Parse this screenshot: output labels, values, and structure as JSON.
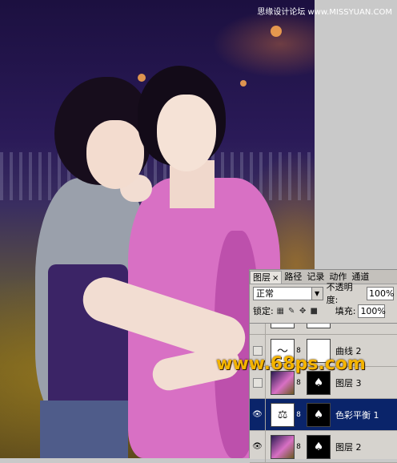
{
  "top_watermark": "思缘设计论坛 www.MISSYUAN.COM",
  "watermark": "www.68ps.com",
  "panel": {
    "tabs": [
      {
        "label": "图层",
        "close": "×",
        "active": true
      },
      {
        "label": "路径",
        "active": false
      },
      {
        "label": "记录",
        "active": false
      },
      {
        "label": "动作",
        "active": false
      },
      {
        "label": "通道",
        "active": false
      }
    ],
    "blend_mode": "正常",
    "opacity_label": "不透明度:",
    "opacity_value": "100%",
    "lock_label": "锁定:",
    "fill_label": "填充:",
    "fill_value": "100%"
  },
  "layers": [
    {
      "name": "",
      "visible": false,
      "selected": false,
      "thumb": "adj",
      "mask": "white"
    },
    {
      "name": "曲线 2",
      "visible": false,
      "selected": false,
      "thumb": "adj",
      "mask": "white"
    },
    {
      "name": "图层 3",
      "visible": false,
      "selected": false,
      "thumb": "photo",
      "mask": "dark"
    },
    {
      "name": "色彩平衡 1",
      "visible": true,
      "selected": true,
      "thumb": "adj",
      "mask": "dark"
    },
    {
      "name": "图层 2",
      "visible": true,
      "selected": false,
      "thumb": "photo",
      "mask": "dark"
    }
  ]
}
